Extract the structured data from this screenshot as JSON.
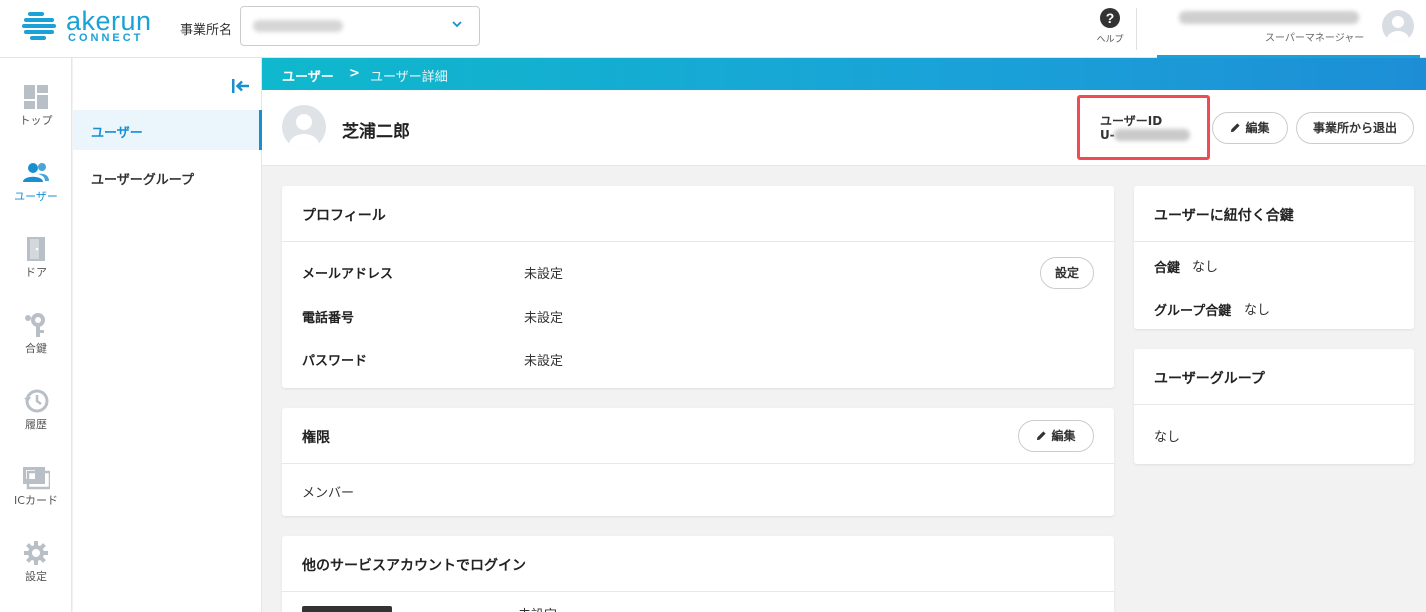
{
  "header": {
    "logo_word": "akerun",
    "logo_sub": "CONNECT",
    "office_label": "事業所名",
    "help_label": "ヘルプ",
    "account_role": "スーパーマネージャー"
  },
  "nav": {
    "items": [
      {
        "label": "トップ",
        "icon": "dashboard-icon"
      },
      {
        "label": "ユーザー",
        "icon": "users-icon"
      },
      {
        "label": "ドア",
        "icon": "door-icon"
      },
      {
        "label": "合鍵",
        "icon": "key-icon"
      },
      {
        "label": "履歴",
        "icon": "history-icon"
      },
      {
        "label": "ICカード",
        "icon": "ic-card-icon"
      },
      {
        "label": "設定",
        "icon": "gear-icon"
      }
    ]
  },
  "subnav": {
    "items": [
      {
        "label": "ユーザー"
      },
      {
        "label": "ユーザーグループ"
      }
    ]
  },
  "breadcrumb": {
    "root": "ユーザー",
    "separator": ">",
    "current": "ユーザー詳細"
  },
  "user": {
    "name": "芝浦二郎",
    "id_label": "ユーザーID",
    "id_prefix": "U-"
  },
  "actions": {
    "edit_label": "編集",
    "leave_label": "事業所から退出"
  },
  "profile": {
    "title": "プロフィール",
    "rows": [
      {
        "label": "メールアドレス",
        "value": "未設定"
      },
      {
        "label": "電話番号",
        "value": "未設定"
      },
      {
        "label": "パスワード",
        "value": "未設定"
      }
    ],
    "set_button": "設定"
  },
  "permission": {
    "title": "権限",
    "edit_label": "編集",
    "value": "メンバー"
  },
  "other_login": {
    "title": "他のサービスアカウントでログイン",
    "row_value": "未設定"
  },
  "keys": {
    "title": "ユーザーに紐付く合鍵",
    "key_label": "合鍵",
    "key_value": "なし",
    "group_key_label": "グループ合鍵",
    "group_key_value": "なし"
  },
  "user_group": {
    "title": "ユーザーグループ",
    "value": "なし"
  },
  "colors": {
    "accent": "#1a8fd0",
    "highlight": "#ef4a56",
    "banner_start": "#0fb8cc",
    "banner_end": "#1d8ed6"
  }
}
